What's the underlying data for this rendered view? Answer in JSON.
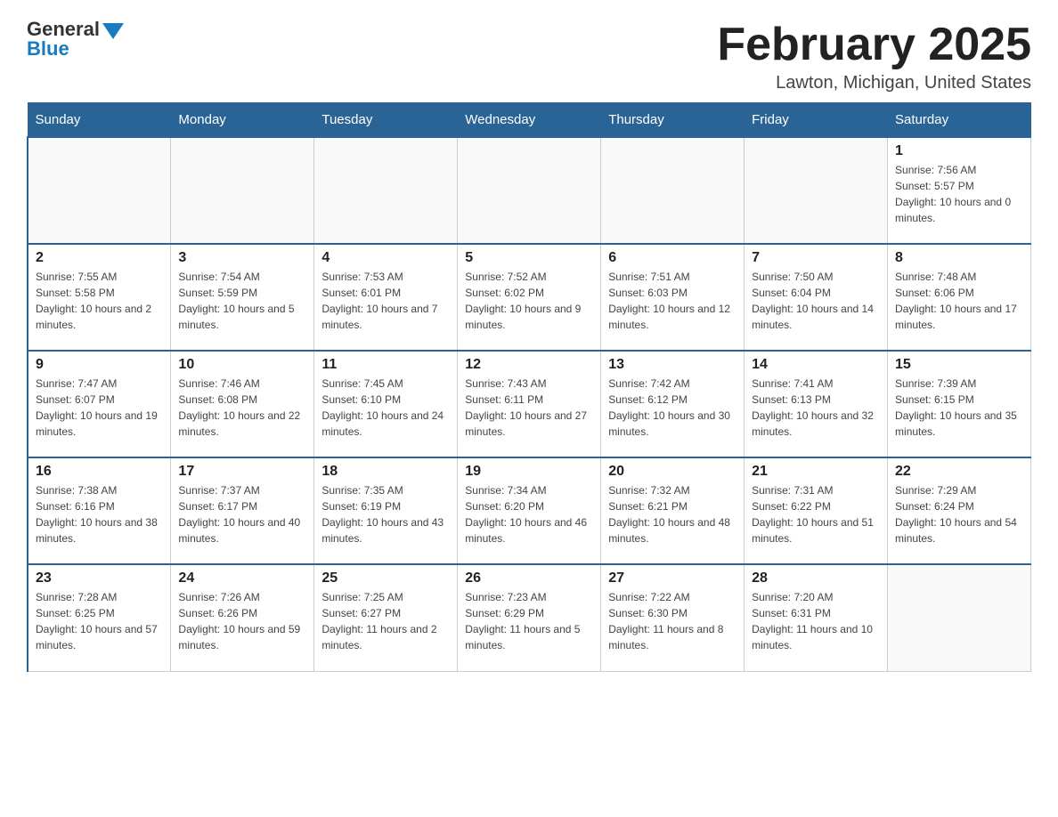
{
  "header": {
    "logo_general": "General",
    "logo_blue": "Blue",
    "month_title": "February 2025",
    "location": "Lawton, Michigan, United States"
  },
  "days_of_week": [
    "Sunday",
    "Monday",
    "Tuesday",
    "Wednesday",
    "Thursday",
    "Friday",
    "Saturday"
  ],
  "weeks": [
    [
      {
        "day": "",
        "info": ""
      },
      {
        "day": "",
        "info": ""
      },
      {
        "day": "",
        "info": ""
      },
      {
        "day": "",
        "info": ""
      },
      {
        "day": "",
        "info": ""
      },
      {
        "day": "",
        "info": ""
      },
      {
        "day": "1",
        "info": "Sunrise: 7:56 AM\nSunset: 5:57 PM\nDaylight: 10 hours and 0 minutes."
      }
    ],
    [
      {
        "day": "2",
        "info": "Sunrise: 7:55 AM\nSunset: 5:58 PM\nDaylight: 10 hours and 2 minutes."
      },
      {
        "day": "3",
        "info": "Sunrise: 7:54 AM\nSunset: 5:59 PM\nDaylight: 10 hours and 5 minutes."
      },
      {
        "day": "4",
        "info": "Sunrise: 7:53 AM\nSunset: 6:01 PM\nDaylight: 10 hours and 7 minutes."
      },
      {
        "day": "5",
        "info": "Sunrise: 7:52 AM\nSunset: 6:02 PM\nDaylight: 10 hours and 9 minutes."
      },
      {
        "day": "6",
        "info": "Sunrise: 7:51 AM\nSunset: 6:03 PM\nDaylight: 10 hours and 12 minutes."
      },
      {
        "day": "7",
        "info": "Sunrise: 7:50 AM\nSunset: 6:04 PM\nDaylight: 10 hours and 14 minutes."
      },
      {
        "day": "8",
        "info": "Sunrise: 7:48 AM\nSunset: 6:06 PM\nDaylight: 10 hours and 17 minutes."
      }
    ],
    [
      {
        "day": "9",
        "info": "Sunrise: 7:47 AM\nSunset: 6:07 PM\nDaylight: 10 hours and 19 minutes."
      },
      {
        "day": "10",
        "info": "Sunrise: 7:46 AM\nSunset: 6:08 PM\nDaylight: 10 hours and 22 minutes."
      },
      {
        "day": "11",
        "info": "Sunrise: 7:45 AM\nSunset: 6:10 PM\nDaylight: 10 hours and 24 minutes."
      },
      {
        "day": "12",
        "info": "Sunrise: 7:43 AM\nSunset: 6:11 PM\nDaylight: 10 hours and 27 minutes."
      },
      {
        "day": "13",
        "info": "Sunrise: 7:42 AM\nSunset: 6:12 PM\nDaylight: 10 hours and 30 minutes."
      },
      {
        "day": "14",
        "info": "Sunrise: 7:41 AM\nSunset: 6:13 PM\nDaylight: 10 hours and 32 minutes."
      },
      {
        "day": "15",
        "info": "Sunrise: 7:39 AM\nSunset: 6:15 PM\nDaylight: 10 hours and 35 minutes."
      }
    ],
    [
      {
        "day": "16",
        "info": "Sunrise: 7:38 AM\nSunset: 6:16 PM\nDaylight: 10 hours and 38 minutes."
      },
      {
        "day": "17",
        "info": "Sunrise: 7:37 AM\nSunset: 6:17 PM\nDaylight: 10 hours and 40 minutes."
      },
      {
        "day": "18",
        "info": "Sunrise: 7:35 AM\nSunset: 6:19 PM\nDaylight: 10 hours and 43 minutes."
      },
      {
        "day": "19",
        "info": "Sunrise: 7:34 AM\nSunset: 6:20 PM\nDaylight: 10 hours and 46 minutes."
      },
      {
        "day": "20",
        "info": "Sunrise: 7:32 AM\nSunset: 6:21 PM\nDaylight: 10 hours and 48 minutes."
      },
      {
        "day": "21",
        "info": "Sunrise: 7:31 AM\nSunset: 6:22 PM\nDaylight: 10 hours and 51 minutes."
      },
      {
        "day": "22",
        "info": "Sunrise: 7:29 AM\nSunset: 6:24 PM\nDaylight: 10 hours and 54 minutes."
      }
    ],
    [
      {
        "day": "23",
        "info": "Sunrise: 7:28 AM\nSunset: 6:25 PM\nDaylight: 10 hours and 57 minutes."
      },
      {
        "day": "24",
        "info": "Sunrise: 7:26 AM\nSunset: 6:26 PM\nDaylight: 10 hours and 59 minutes."
      },
      {
        "day": "25",
        "info": "Sunrise: 7:25 AM\nSunset: 6:27 PM\nDaylight: 11 hours and 2 minutes."
      },
      {
        "day": "26",
        "info": "Sunrise: 7:23 AM\nSunset: 6:29 PM\nDaylight: 11 hours and 5 minutes."
      },
      {
        "day": "27",
        "info": "Sunrise: 7:22 AM\nSunset: 6:30 PM\nDaylight: 11 hours and 8 minutes."
      },
      {
        "day": "28",
        "info": "Sunrise: 7:20 AM\nSunset: 6:31 PM\nDaylight: 11 hours and 10 minutes."
      },
      {
        "day": "",
        "info": ""
      }
    ]
  ]
}
